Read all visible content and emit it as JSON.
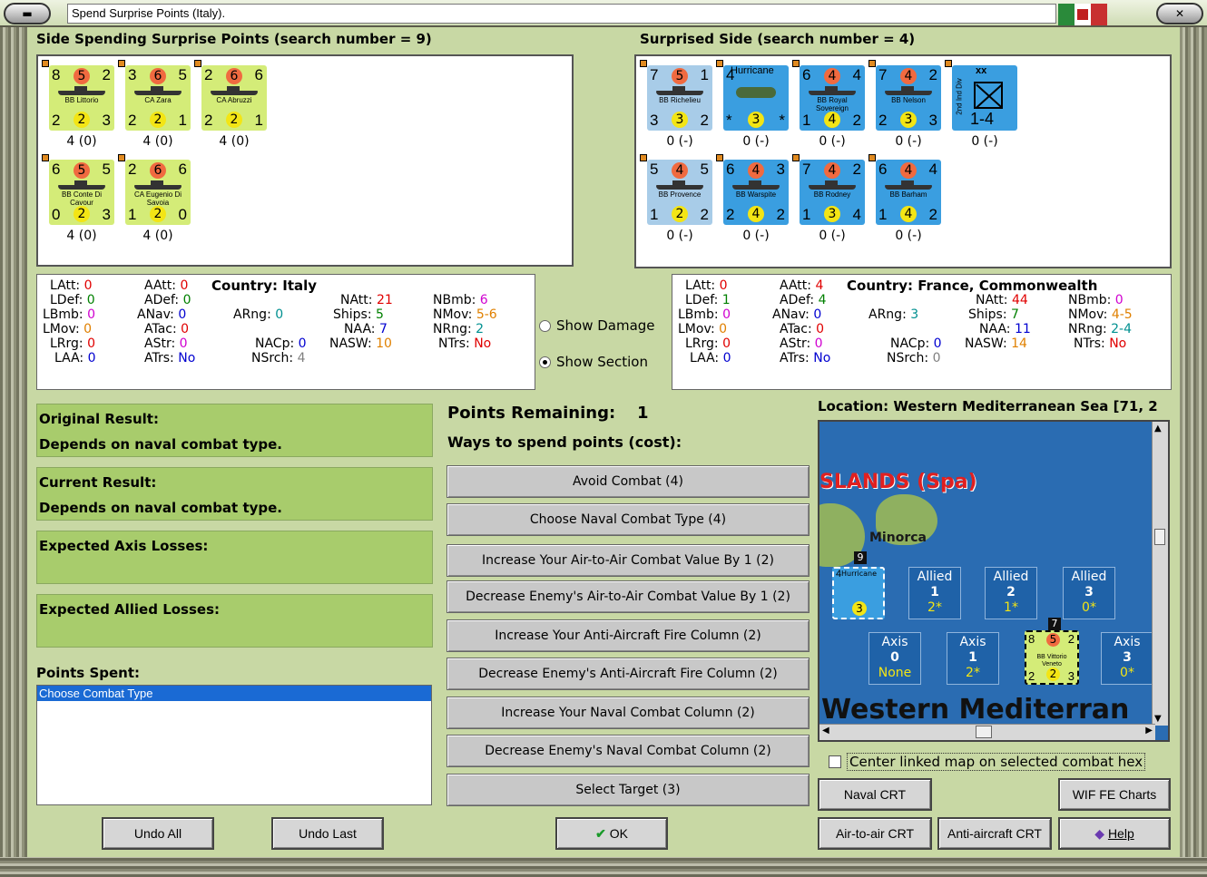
{
  "window": {
    "title": "Spend Surprise Points (Italy)."
  },
  "left_header": "Side Spending Surprise Points (search number = 9)",
  "right_header": "Surprised Side (search number = 4)",
  "italy_units": [
    {
      "a": "8",
      "b": "5",
      "c": "2",
      "name": "BB Littorio",
      "d": "2",
      "e": "2",
      "f": "3",
      "cap": "4 (0)"
    },
    {
      "a": "3",
      "b": "6",
      "c": "5",
      "name": "CA Zara",
      "d": "2",
      "e": "2",
      "f": "1",
      "cap": "4 (0)"
    },
    {
      "a": "2",
      "b": "6",
      "c": "6",
      "name": "CA Abruzzi",
      "d": "2",
      "e": "2",
      "f": "1",
      "cap": "4 (0)"
    },
    {
      "a": "6",
      "b": "5",
      "c": "5",
      "name": "BB Conte Di Cavour",
      "d": "0",
      "e": "2",
      "f": "3",
      "cap": "4 (0)"
    },
    {
      "a": "2",
      "b": "6",
      "c": "6",
      "name": "CA Eugenio Di Savoia",
      "d": "1",
      "e": "2",
      "f": "0",
      "cap": "4 (0)"
    }
  ],
  "allied_units": [
    {
      "a": "7",
      "b": "5",
      "c": "1",
      "name": "BB Richelieu",
      "d": "3",
      "e": "3",
      "f": "2",
      "cap": "0 (-)",
      "color": "#a8cce8"
    },
    {
      "a": "4",
      "b": "",
      "c": "",
      "name": "Hurricane",
      "d": "*",
      "e": "3",
      "f": "*",
      "cap": "0 (-)",
      "color": "#3a9ee0"
    },
    {
      "a": "6",
      "b": "4",
      "c": "4",
      "name": "BB Royal Sovereign",
      "d": "1",
      "e": "4",
      "f": "2",
      "cap": "0 (-)",
      "color": "#3a9ee0"
    },
    {
      "a": "7",
      "b": "4",
      "c": "2",
      "name": "BB Nelson",
      "d": "2",
      "e": "3",
      "f": "3",
      "cap": "0 (-)",
      "color": "#3a9ee0"
    },
    {
      "a": "xx",
      "b": "",
      "c": "",
      "name": "2nd Ind Div",
      "d": "",
      "e": "1-4",
      "f": "",
      "cap": "0 (-)",
      "color": "#3a9ee0"
    },
    {
      "a": "5",
      "b": "4",
      "c": "5",
      "name": "BB Provence",
      "d": "1",
      "e": "2",
      "f": "2",
      "cap": "0 (-)",
      "color": "#a8cce8"
    },
    {
      "a": "6",
      "b": "4",
      "c": "3",
      "name": "BB Warspite",
      "d": "2",
      "e": "4",
      "f": "2",
      "cap": "0 (-)",
      "color": "#3a9ee0"
    },
    {
      "a": "7",
      "b": "4",
      "c": "2",
      "name": "BB Rodney",
      "d": "1",
      "e": "3",
      "f": "4",
      "cap": "0 (-)",
      "color": "#3a9ee0"
    },
    {
      "a": "6",
      "b": "4",
      "c": "4",
      "name": "BB Barham",
      "d": "1",
      "e": "4",
      "f": "2",
      "cap": "0 (-)",
      "color": "#3a9ee0"
    }
  ],
  "italy_stats": {
    "LAtt": "0",
    "LDef": "0",
    "LBmb": "0",
    "LMov": "0",
    "LRrg": "0",
    "LAA": "0",
    "AAtt": "0",
    "ADef": "0",
    "ANav": "0",
    "ATac": "0",
    "AStr": "0",
    "ATrs": "No",
    "country": "Country: Italy",
    "ARng": "0",
    "NACp": "0",
    "NSrch": "4",
    "NAtt": "21",
    "Ships": "5",
    "NAA": "7",
    "NASW": "10",
    "NBmb": "6",
    "NMov": "5-6",
    "NRng": "2",
    "NTrs": "No"
  },
  "allied_stats": {
    "LAtt": "0",
    "LDef": "1",
    "LBmb": "0",
    "LMov": "0",
    "LRrg": "0",
    "LAA": "0",
    "AAtt": "4",
    "ADef": "4",
    "ANav": "0",
    "ATac": "0",
    "AStr": "0",
    "ATrs": "No",
    "country": "Country: France, Commonwealth",
    "ARng": "3",
    "NACp": "0",
    "NSrch": "0",
    "NAtt": "44",
    "Ships": "7",
    "NAA": "11",
    "NASW": "14",
    "NBmb": "0",
    "NMov": "4-5",
    "NRng": "2-4",
    "NTrs": "No"
  },
  "labels": {
    "LAtt": "LAtt:",
    "LDef": "LDef:",
    "LBmb": "LBmb:",
    "LMov": "LMov:",
    "LRrg": "LRrg:",
    "LAA": "LAA:",
    "AAtt": "AAtt:",
    "ADef": "ADef:",
    "ANav": "ANav:",
    "ATac": "ATac:",
    "AStr": "AStr:",
    "ATrs": "ATrs:",
    "ARng": "ARng:",
    "NACp": "NACp:",
    "NSrch": "NSrch:",
    "NAtt": "NAtt:",
    "Ships": "Ships:",
    "NAA": "NAA:",
    "NASW": "NASW:",
    "NBmb": "NBmb:",
    "NMov": "NMov:",
    "NRng": "NRng:",
    "NTrs": "NTrs:"
  },
  "options": {
    "show_damage": "Show Damage",
    "show_section": "Show Section",
    "selected": "show_section"
  },
  "results": {
    "original_label": "Original Result:",
    "original_value": "Depends on naval combat type.",
    "current_label": "Current Result:",
    "current_value": "Depends on naval combat type.",
    "axis_losses_label": "Expected Axis Losses:",
    "allied_losses_label": "Expected Allied Losses:"
  },
  "points": {
    "remaining_label": "Points Remaining:",
    "remaining_value": "1",
    "ways_label": "Ways to spend points (cost):",
    "spent_label": "Points Spent:",
    "spent_items": [
      "Choose Combat Type"
    ]
  },
  "actions": [
    "Avoid Combat (4)",
    "Choose Naval Combat Type (4)",
    "Increase Your Air-to-Air Combat Value By 1 (2)",
    "Decrease Enemy's Air-to-Air Combat Value By 1 (2)",
    "Increase Your Anti-Aircraft Fire Column (2)",
    "Decrease Enemy's Anti-Aircraft Fire Column (2)",
    "Increase Your Naval Combat Column (2)",
    "Decrease Enemy's Naval Combat Column (2)",
    "Select Target (3)"
  ],
  "map": {
    "location": "Location: Western Mediterranean Sea [71, 2",
    "region_label": "SLANDS (Spa)",
    "island": "Minorca",
    "sea_label": "Western Mediterran",
    "stack_count_top": "9",
    "stack_count_axis": "7",
    "allied_boxes": [
      {
        "side": "Allied",
        "num": "1",
        "val": "2*"
      },
      {
        "side": "Allied",
        "num": "2",
        "val": "1*"
      },
      {
        "side": "Allied",
        "num": "3",
        "val": "0*"
      }
    ],
    "axis_boxes": [
      {
        "side": "Axis",
        "num": "0",
        "val": "None"
      },
      {
        "side": "Axis",
        "num": "1",
        "val": "2*"
      },
      {
        "side": "Axis",
        "num": "3",
        "val": "0*"
      }
    ],
    "hurricane": {
      "a": "4",
      "name": "Hurricane",
      "e": "3"
    },
    "vittorio": {
      "a": "8",
      "b": "5",
      "c": "2",
      "name": "BB Vittorio Veneto",
      "d": "2",
      "e": "2",
      "f": "3"
    }
  },
  "center_checkbox": "Center linked map on selected combat hex",
  "buttons": {
    "undo_all": "Undo All",
    "undo_last": "Undo Last",
    "ok": "OK",
    "naval_crt": "Naval CRT",
    "wif_fe": "WIF FE Charts",
    "air_crt": "Air-to-air CRT",
    "aa_crt": "Anti-aircraft CRT",
    "help": "Help"
  },
  "colors": {
    "panel_bg": "#c8d8a4",
    "result_bg": "#a8cc6c",
    "italy_counter": "#d4ec78",
    "allied_counter": "#3a9ee0",
    "list_selection": "#1a6ad4"
  }
}
